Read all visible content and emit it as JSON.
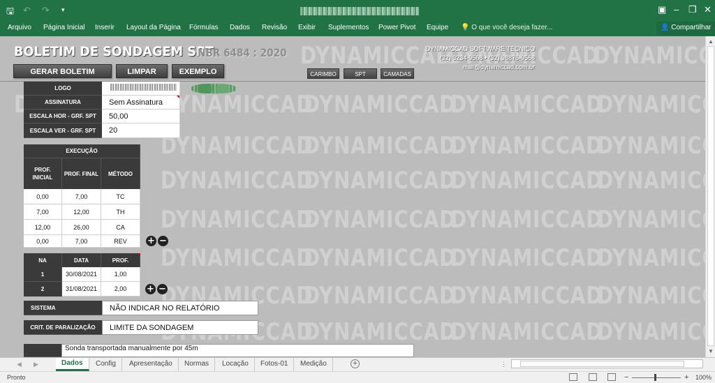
{
  "ribbon": {
    "tabs": [
      "Arquivo",
      "Página Inicial",
      "Inserir",
      "Layout da Página",
      "Fórmulas",
      "Dados",
      "Revisão",
      "Exibir",
      "Suplementos",
      "Power Pivot",
      "Equipe"
    ],
    "tell_me": "O que você deseja fazer...",
    "share": "Compartilhar"
  },
  "watermark": "DYNAMICCAD",
  "header": {
    "title": "BOLETIM DE SONDAGEM SPT",
    "norm": "NBR 6484 : 2020",
    "buttons": {
      "gerar": "GERAR BOLETIM",
      "limpar": "LIMPAR",
      "exemplo": "EXEMPLO"
    },
    "small_buttons": {
      "carimbo": "CARIMBO",
      "spt": "SPT",
      "camadas": "CAMADAS"
    },
    "contact": {
      "company": "DYNAMICCAD SOFTWARE TÉCNICO",
      "phones": "(32) 3234-9568 • (32) 98876-9568",
      "email": "mail@dynamiccad.com.br"
    }
  },
  "settings": {
    "logo_label": "LOGO",
    "assinatura_label": "ASSINATURA",
    "assinatura_value": "Sem Assinatura",
    "escala_hor_label": "ESCALA HOR - GRF. SPT",
    "escala_hor_value": "50,00",
    "escala_ver_label": "ESCALA VER - GRF. SPT",
    "escala_ver_value": "20"
  },
  "execucao": {
    "title": "EXECUÇÃO",
    "col_prof_inicial": "PROF. INICIAL",
    "col_prof_final": "PROF. FINAL",
    "col_metodo": "MÉTODO",
    "rows": [
      {
        "ini": "0,00",
        "fim": "7,00",
        "met": "TC"
      },
      {
        "ini": "7,00",
        "fim": "12,00",
        "met": "TH"
      },
      {
        "ini": "12,00",
        "fim": "26,00",
        "met": "CA"
      },
      {
        "ini": "0,00",
        "fim": "7,00",
        "met": "REV"
      }
    ]
  },
  "na": {
    "col_na": "NA",
    "col_data": "DATA",
    "col_prof": "PROF.",
    "rows": [
      {
        "n": "1",
        "data": "30/08/2021",
        "prof": "1,00"
      },
      {
        "n": "2",
        "data": "31/08/2021",
        "prof": "2,00"
      }
    ]
  },
  "sistema": {
    "label": "SISTEMA",
    "value": "NÃO INDICAR NO RELATÓRIO"
  },
  "criterio": {
    "label": "CRIT. DE PARALIZAÇÃO",
    "value": "LIMITE DA SONDAGEM"
  },
  "obs": {
    "text": "Sonda transportada manualmente por 45m"
  },
  "sheets": [
    "Dados",
    "Config",
    "Apresentação",
    "Normas",
    "Locação",
    "Fotos-01",
    "Medição"
  ],
  "status": {
    "ready": "Pronto",
    "zoom": "100%"
  }
}
